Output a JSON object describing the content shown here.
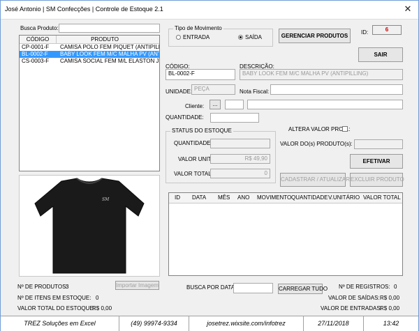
{
  "window": {
    "title": "José Antonio   |   SM Confecções   |   Controle de Estoque 2.1",
    "close_glyph": "✕"
  },
  "left": {
    "busca_label": "Busca Produto:",
    "busca_value": "",
    "columns": [
      "CÓDIGO",
      "PRODUTO"
    ],
    "rows": [
      {
        "codigo": "CP-0001-F",
        "produto": "CAMISA POLO FEM PIQUET (ANTIPILLING)",
        "selected": false
      },
      {
        "codigo": "BL-0002-F",
        "produto": "BABY LOOK FEM M/C MALHA PV (ANTIPILLING)",
        "selected": true
      },
      {
        "codigo": "CS-0003-F",
        "produto": "CAMISA SOCIAL FEM M/L ELASTON JET",
        "selected": false
      }
    ],
    "image_logo_text": "SM",
    "importar_label": "Importar Imagem",
    "n_produtos_label": "Nº DE PRODUTOS:",
    "n_produtos_value": "3",
    "n_itens_label": "Nº DE ITENS EM ESTOQUE:",
    "n_itens_value": "0",
    "valor_total_label": "VALOR TOTAL DO ESTOQUE:",
    "valor_total_value": "R$ 0,00"
  },
  "movimento": {
    "group_label": "Tipo de Movimento",
    "entrada_label": "ENTRADA",
    "saida_label": "SAÍDA",
    "selected": "saida"
  },
  "top_buttons": {
    "gerenciar": "GERENCIAR PRODUTOS",
    "sair": "SAIR"
  },
  "id": {
    "label": "ID:",
    "value": "6"
  },
  "form": {
    "codigo_label": "CÓDIGO:",
    "codigo_value": "BL-0002-F",
    "descricao_label": "DESCRIÇÃO:",
    "descricao_value": "BABY LOOK FEM M/C MALHA PV (ANTIPILLING)",
    "unidade_label": "UNIDADE:",
    "unidade_value": "PEÇA",
    "nota_label": "Nota Fiscal:",
    "nota_value": "",
    "cliente_label": "Cliente:",
    "cliente_btn": "...",
    "quantidade_label": "QUANTIDADE:",
    "quantidade_value": ""
  },
  "status": {
    "group_label": "STATUS DO ESTOQUE",
    "quantidade_label": "QUANTIDADE:",
    "quantidade_value": "",
    "valor_unit_label": "VALOR UNIT:",
    "valor_unit_value": "R$ 49,90",
    "valor_total_label": "VALOR TOTAL:",
    "valor_total_value": "0"
  },
  "altera": {
    "label": "ALTERA VALOR PROD.:",
    "valor_label": "VALOR DO(s) PRODUTO(s):",
    "valor_value": ""
  },
  "actions": {
    "efetivar": "EFETIVAR",
    "cadastrar": "CADASTRAR / ATUALIZAR",
    "excluir": "EXCLUIR PRODUTO"
  },
  "grid": {
    "columns": [
      "ID",
      "DATA",
      "MÊS",
      "ANO",
      "MOVIMENTO",
      "QUANTIDADE",
      "V.UNITÁRIO",
      "VALOR TOTAL"
    ]
  },
  "bottom": {
    "busca_data_label": "BUSCA POR DATA:",
    "busca_data_value": "",
    "carregar": "CARREGAR TUDO",
    "n_registros_label": "Nº DE REGISTROS:",
    "n_registros_value": "0",
    "valor_saidas_label": "VALOR DE SAÍDAS:",
    "valor_saidas_value": "R$ 0,00",
    "valor_entradas_label": "VALOR DE ENTRADAS:",
    "valor_entradas_value": "R$ 0,00"
  },
  "footer": {
    "company": "TREZ Soluções em Excel",
    "phone": "(49) 99974-9334",
    "site": "josetrez.wixsite.com/infotrez",
    "date": "27/11/2018",
    "time": "13:42"
  },
  "colors": {
    "selection": "#3399ff",
    "id_value": "#cc0000",
    "window_border": "#6f9ed6"
  }
}
